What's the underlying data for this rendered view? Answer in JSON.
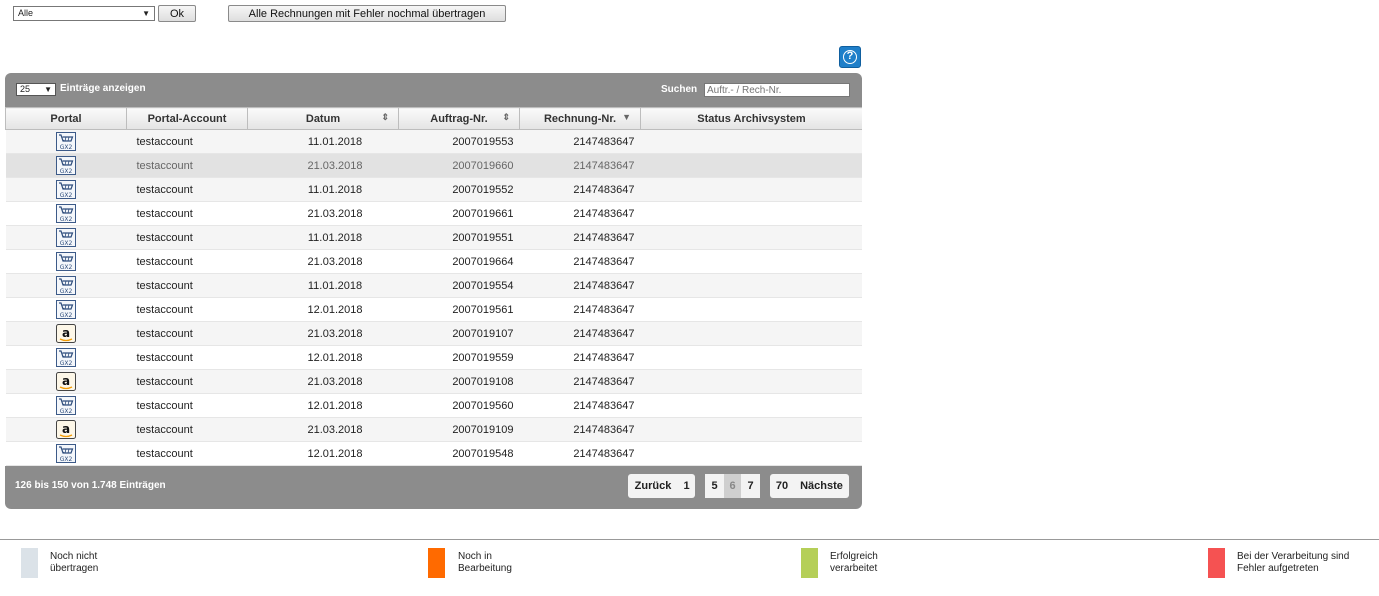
{
  "toolbar": {
    "filter_value": "Alle",
    "ok_label": "Ok",
    "retransmit_label": "Alle Rechnungen mit Fehler nochmal übertragen"
  },
  "help": {
    "icon": "question-icon",
    "color": "#1f7fc9"
  },
  "table": {
    "length_value": "25",
    "length_label": "Einträge anzeigen",
    "search_label": "Suchen",
    "search_placeholder": "Auftr.- / Rech-Nr.",
    "columns": [
      "Portal",
      "Portal-Account",
      "Datum",
      "Auftrag-Nr.",
      "Rechnung-Nr.",
      "Status Archivsystem"
    ],
    "rows": [
      {
        "portal": "gx2",
        "account": "testaccount",
        "date": "11.01.2018",
        "order": "2007019553",
        "invoice": "2147483647",
        "status": ""
      },
      {
        "portal": "gx2",
        "account": "testaccount",
        "date": "21.03.2018",
        "order": "2007019660",
        "invoice": "2147483647",
        "status": ""
      },
      {
        "portal": "gx2",
        "account": "testaccount",
        "date": "11.01.2018",
        "order": "2007019552",
        "invoice": "2147483647",
        "status": ""
      },
      {
        "portal": "gx2",
        "account": "testaccount",
        "date": "21.03.2018",
        "order": "2007019661",
        "invoice": "2147483647",
        "status": ""
      },
      {
        "portal": "gx2",
        "account": "testaccount",
        "date": "11.01.2018",
        "order": "2007019551",
        "invoice": "2147483647",
        "status": ""
      },
      {
        "portal": "gx2",
        "account": "testaccount",
        "date": "21.03.2018",
        "order": "2007019664",
        "invoice": "2147483647",
        "status": ""
      },
      {
        "portal": "gx2",
        "account": "testaccount",
        "date": "11.01.2018",
        "order": "2007019554",
        "invoice": "2147483647",
        "status": ""
      },
      {
        "portal": "gx2",
        "account": "testaccount",
        "date": "12.01.2018",
        "order": "2007019561",
        "invoice": "2147483647",
        "status": ""
      },
      {
        "portal": "amazon",
        "account": "testaccount",
        "date": "21.03.2018",
        "order": "2007019107",
        "invoice": "2147483647",
        "status": ""
      },
      {
        "portal": "gx2",
        "account": "testaccount",
        "date": "12.01.2018",
        "order": "2007019559",
        "invoice": "2147483647",
        "status": ""
      },
      {
        "portal": "amazon",
        "account": "testaccount",
        "date": "21.03.2018",
        "order": "2007019108",
        "invoice": "2147483647",
        "status": ""
      },
      {
        "portal": "gx2",
        "account": "testaccount",
        "date": "12.01.2018",
        "order": "2007019560",
        "invoice": "2147483647",
        "status": ""
      },
      {
        "portal": "amazon",
        "account": "testaccount",
        "date": "21.03.2018",
        "order": "2007019109",
        "invoice": "2147483647",
        "status": ""
      },
      {
        "portal": "gx2",
        "account": "testaccount",
        "date": "12.01.2018",
        "order": "2007019548",
        "invoice": "2147483647",
        "status": ""
      }
    ],
    "info": "126 bis 150 von 1.748 Einträgen",
    "pagination": {
      "prev": "Zurück",
      "p1": "1",
      "p5": "5",
      "p6": "6",
      "p7": "7",
      "p70": "70",
      "next": "Nächste"
    }
  },
  "legend": [
    {
      "line1": "Noch nicht",
      "line2": "übertragen",
      "color": "#dbe2e8"
    },
    {
      "line1": "Noch in",
      "line2": "Bearbeitung",
      "color": "#ff6a00"
    },
    {
      "line1": "Erfolgreich",
      "line2": "verarbeitet",
      "color": "#b5cf58"
    },
    {
      "line1": "Bei der Verarbeitung sind",
      "line2": "Fehler aufgetreten",
      "color": "#f55252"
    }
  ]
}
